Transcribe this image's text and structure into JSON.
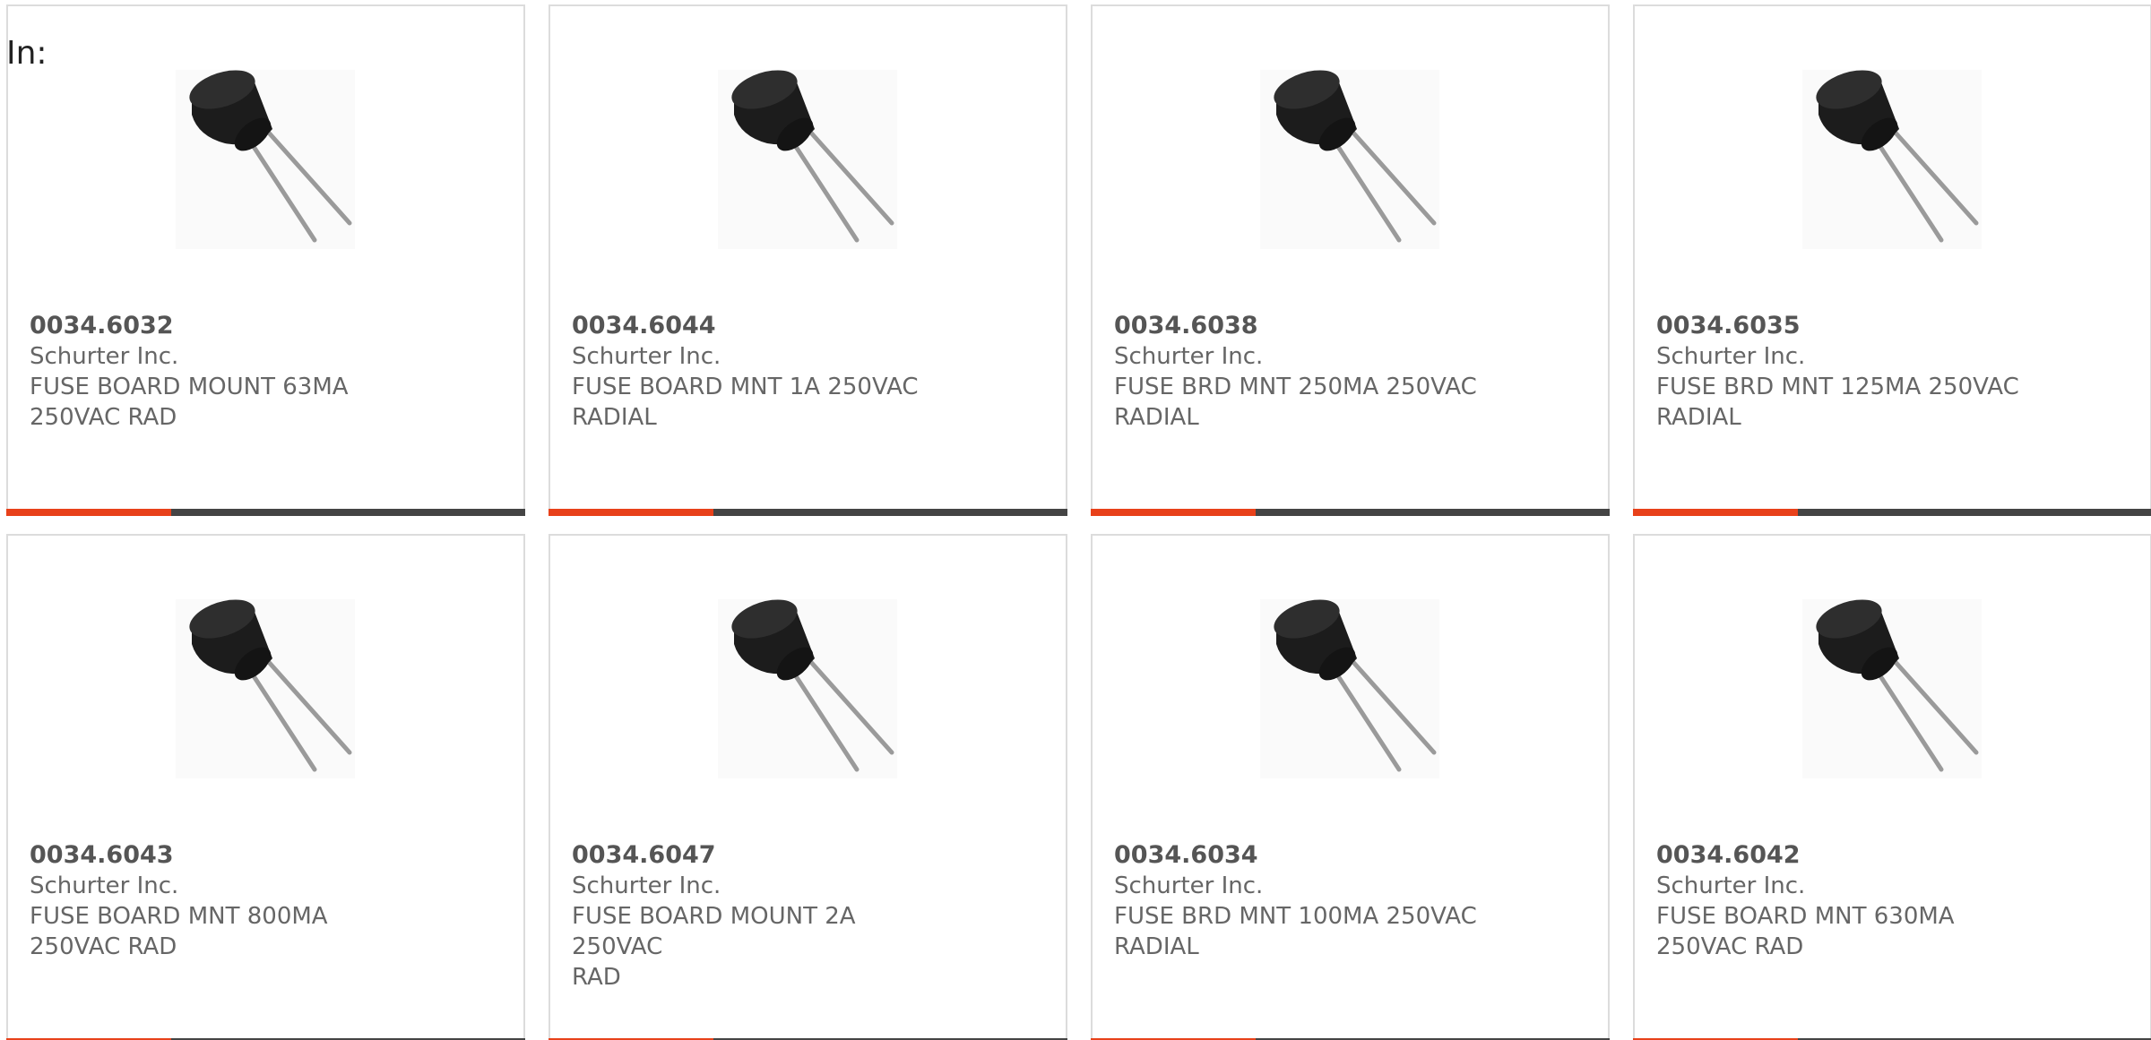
{
  "header": {
    "in_label": "In:"
  },
  "theme": {
    "accent": "#e8411a",
    "bar_dark": "#444444",
    "text": "#666666",
    "border": "#dcdcdc"
  },
  "products": [
    {
      "part_number": "0034.6032",
      "manufacturer": "Schurter Inc.",
      "description_line1": "FUSE BOARD MOUNT 63MA",
      "description_line2": "250VAC RAD",
      "image_icon": "radial-fuse-image"
    },
    {
      "part_number": "0034.6044",
      "manufacturer": "Schurter Inc.",
      "description_line1": "FUSE BOARD MNT 1A 250VAC",
      "description_line2": "RADIAL",
      "image_icon": "radial-fuse-image"
    },
    {
      "part_number": "0034.6038",
      "manufacturer": "Schurter Inc.",
      "description_line1": "FUSE BRD MNT 250MA 250VAC",
      "description_line2": "RADIAL",
      "image_icon": "radial-fuse-image"
    },
    {
      "part_number": "0034.6035",
      "manufacturer": "Schurter Inc.",
      "description_line1": "FUSE BRD MNT 125MA 250VAC",
      "description_line2": "RADIAL",
      "image_icon": "radial-fuse-image"
    },
    {
      "part_number": "0034.6043",
      "manufacturer": "Schurter Inc.",
      "description_line1": "FUSE BOARD MNT 800MA",
      "description_line2": "250VAC RAD",
      "image_icon": "radial-fuse-image"
    },
    {
      "part_number": "0034.6047",
      "manufacturer": "Schurter Inc.",
      "description_line1": "FUSE BOARD MOUNT 2A 250VAC",
      "description_line2": "RAD",
      "image_icon": "radial-fuse-image"
    },
    {
      "part_number": "0034.6034",
      "manufacturer": "Schurter Inc.",
      "description_line1": "FUSE BRD MNT 100MA 250VAC",
      "description_line2": "RADIAL",
      "image_icon": "radial-fuse-image"
    },
    {
      "part_number": "0034.6042",
      "manufacturer": "Schurter Inc.",
      "description_line1": "FUSE BOARD MNT 630MA",
      "description_line2": "250VAC RAD",
      "image_icon": "radial-fuse-image"
    }
  ]
}
